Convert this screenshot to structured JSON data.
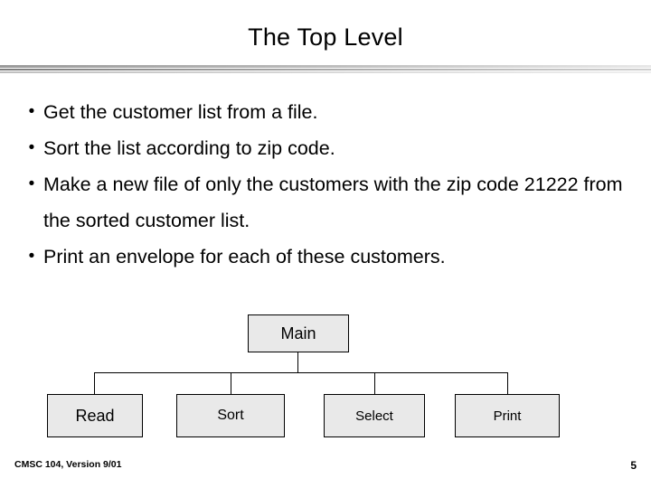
{
  "slide": {
    "title": "The Top Level",
    "bullets": [
      {
        "marker": "•",
        "text": "Get the customer list from a file."
      },
      {
        "marker": "•",
        "text": "Sort the list according to zip code."
      },
      {
        "marker": "•",
        "text": "Make a new file of only the customers with the zip code 21222 from the sorted customer list."
      },
      {
        "marker": "•",
        "text": "Print an envelope for each of these customers."
      }
    ],
    "diagram": {
      "root": {
        "label": "Main"
      },
      "children": [
        {
          "label": "Read"
        },
        {
          "label": "Sort"
        },
        {
          "label": "Select"
        },
        {
          "label": "Print"
        }
      ]
    },
    "footer": {
      "left": "CMSC 104, Version 9/01",
      "page_number": "5"
    },
    "colors": {
      "node_fill": "#e9e9e9",
      "node_border": "#000000",
      "text": "#000000",
      "rule": "#9a9a9a"
    }
  }
}
